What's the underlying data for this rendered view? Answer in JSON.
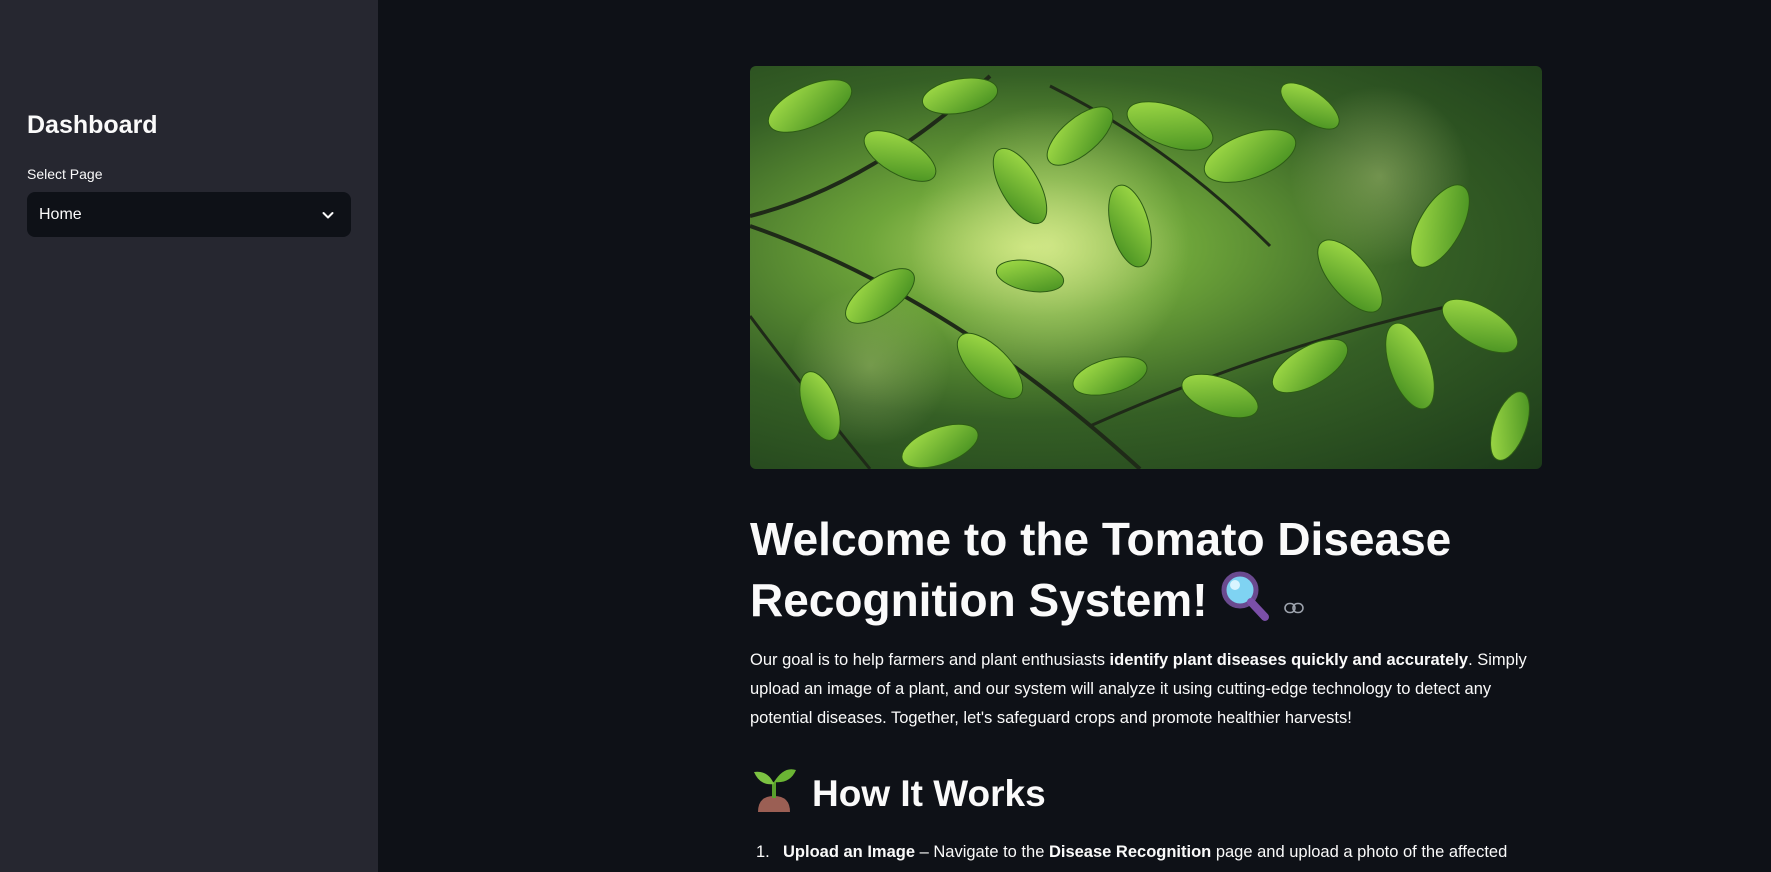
{
  "sidebar": {
    "title": "Dashboard",
    "select_label": "Select Page",
    "select_value": "Home"
  },
  "main": {
    "hero_alt": "green leaves",
    "title": "Welcome to the Tomato Disease Recognition System!",
    "title_icon": "magnifying-glass-icon",
    "intro": {
      "part1": "Our goal is to help farmers and plant enthusiasts ",
      "bold": "identify plant diseases quickly and accurately",
      "part2": ". Simply upload an image of a plant, and our system will analyze it using cutting-edge technology to detect any potential diseases. Together, let's safeguard crops and promote healthier harvests!"
    },
    "section_heading": "How It Works",
    "section_icon": "seedling-icon",
    "steps": [
      {
        "num": "1.",
        "bold1": "Upload an Image",
        "text1": " – Navigate to the ",
        "bold2": "Disease Recognition",
        "text2": " page and upload a photo of the affected"
      }
    ]
  }
}
